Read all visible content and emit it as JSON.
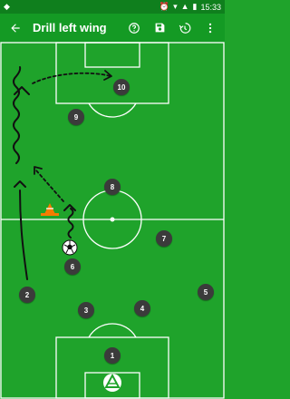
{
  "status_bar": {
    "time": "15:33",
    "icons": [
      "alarm-icon",
      "wifi-icon",
      "cellular-signal-icon",
      "battery-icon"
    ]
  },
  "app_bar": {
    "title": "Drill left wing",
    "icons": [
      "back-arrow-icon",
      "help-icon",
      "save-icon",
      "history-icon",
      "more-vert-icon"
    ]
  },
  "players": [
    {
      "label": "1"
    },
    {
      "label": "2"
    },
    {
      "label": "3"
    },
    {
      "label": "4"
    },
    {
      "label": "5"
    },
    {
      "label": "6"
    },
    {
      "label": "7"
    },
    {
      "label": "8"
    },
    {
      "label": "9"
    },
    {
      "label": "10"
    }
  ],
  "colors": {
    "field": "#1fa32b",
    "appbar": "#149a24",
    "statusbar": "#0f7f1d",
    "player": "#3b3b3b",
    "cone": "#f57c00"
  }
}
